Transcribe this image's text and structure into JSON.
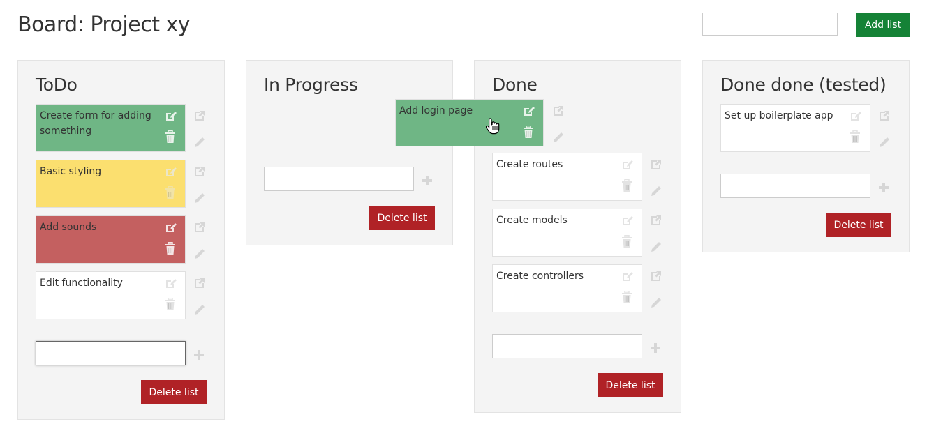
{
  "header": {
    "title": "Board: Project xy",
    "new_list_placeholder": "",
    "new_list_value": "",
    "add_list_label": "Add list"
  },
  "colors": {
    "add_button": "#158236",
    "delete_button": "#b02226",
    "card_green": "#6fb685",
    "card_yellow": "#fbdf6f",
    "card_red": "#c46060",
    "list_bg": "#f4f4f4"
  },
  "lists": [
    {
      "title": "ToDo",
      "cards": [
        {
          "text": "Create form for adding something",
          "color": "green"
        },
        {
          "text": "Basic styling",
          "color": "yellow"
        },
        {
          "text": "Add sounds",
          "color": "red"
        },
        {
          "text": "Edit functionality",
          "color": "white"
        }
      ],
      "new_card_value": "",
      "new_card_focused": true,
      "delete_label": "Delete list"
    },
    {
      "title": "In Progress",
      "cards": [],
      "new_card_value": "",
      "delete_label": "Delete list"
    },
    {
      "title": "Done",
      "cards": [
        {
          "text": "Create routes",
          "color": "white"
        },
        {
          "text": "Create models",
          "color": "white"
        },
        {
          "text": "Create controllers",
          "color": "white"
        }
      ],
      "new_card_value": "",
      "delete_label": "Delete list"
    },
    {
      "title": "Done done (tested)",
      "cards": [
        {
          "text": "Set up boilerplate app",
          "color": "white"
        }
      ],
      "new_card_value": "",
      "delete_label": "Delete list"
    }
  ],
  "dragging_card": {
    "text": "Add login page",
    "color": "green"
  },
  "icons": {
    "card_edit": "edit-square-icon",
    "card_delete": "trash-icon",
    "card_open": "external-link-icon",
    "card_rename": "pencil-icon",
    "add_card": "plus-icon",
    "cursor": "hand-grab-cursor"
  }
}
